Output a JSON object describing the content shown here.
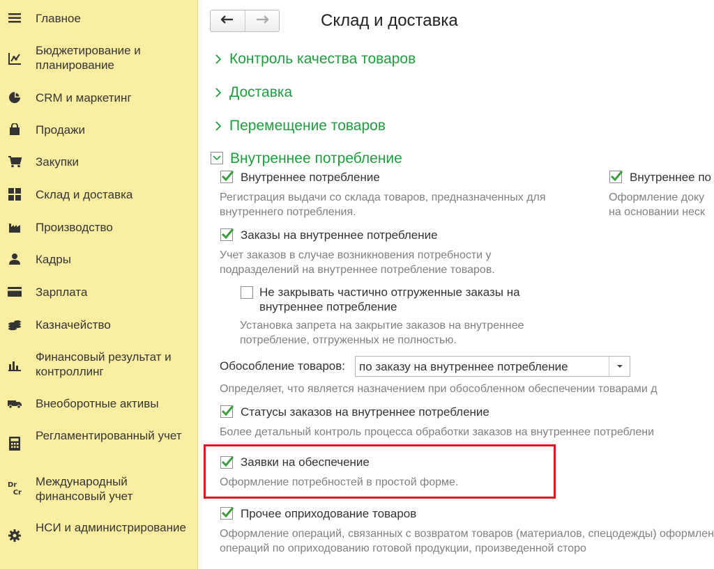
{
  "sidebar": {
    "items": [
      {
        "label": "Главное",
        "icon": "menu-icon"
      },
      {
        "label": "Бюджетирование и планирование",
        "icon": "budget-chart-icon"
      },
      {
        "label": "CRM и маркетинг",
        "icon": "pie-chart-icon"
      },
      {
        "label": "Продажи",
        "icon": "shopping-bag-icon"
      },
      {
        "label": "Закупки",
        "icon": "cart-icon"
      },
      {
        "label": "Склад и доставка",
        "icon": "warehouse-grid-icon"
      },
      {
        "label": "Производство",
        "icon": "factory-icon"
      },
      {
        "label": "Кадры",
        "icon": "person-icon"
      },
      {
        "label": "Зарплата",
        "icon": "wallet-icon"
      },
      {
        "label": "Казначейство",
        "icon": "coins-icon"
      },
      {
        "label": "Финансовый результат и контроллинг",
        "icon": "bar-chart-icon"
      },
      {
        "label": "Внеоборотные активы",
        "icon": "truck-icon"
      },
      {
        "label": "Регламентированный учет",
        "icon": "calculator-icon"
      },
      {
        "label": "Международный финансовый учет",
        "icon": "dr-cr-icon",
        "icon_text": "Dr\nCr"
      },
      {
        "label": "НСИ и администрирование",
        "icon": "gear-icon"
      }
    ]
  },
  "header": {
    "back": "←",
    "forward": "→",
    "title": "Склад и доставка"
  },
  "sections": {
    "quality": "Контроль качества товаров",
    "delivery": "Доставка",
    "movement": "Перемещение товаров",
    "internal": "Внутреннее потребление"
  },
  "options": {
    "internal": {
      "label": "Внутреннее потребление",
      "checked": true,
      "desc": "Регистрация выдачи со склада товаров, предназначенных для внутреннего потребления."
    },
    "internal_right": {
      "label": "Внутреннее по",
      "checked": true,
      "desc": "Оформление доку на основании неск"
    },
    "orders": {
      "label": "Заказы на внутреннее потребление",
      "checked": true,
      "desc": "Учет заказов в случае возникновения потребности у подразделений на внутреннее потребление товаров."
    },
    "no_close": {
      "label": "Не закрывать частично отгруженные заказы на внутреннее потребление",
      "checked": false,
      "desc": "Установка запрета на закрытие заказов на внутреннее потребление, отгруженных не полностью."
    },
    "isolation": {
      "label": "Обособление товаров:",
      "value": "по заказу на внутреннее потребление",
      "desc": "Определяет, что является назначением при обособленном обеспечении товарами д"
    },
    "statuses": {
      "label": "Статусы заказов на внутреннее потребление",
      "checked": true,
      "desc": "Более детальный контроль процесса обработки заказов на внутреннее потреблени"
    },
    "requests": {
      "label": "Заявки на обеспечение",
      "checked": true,
      "desc": "Оформление потребностей в простой форме."
    },
    "other": {
      "label": "Прочее оприходование товаров",
      "checked": true,
      "desc": "Оформление операций, связанных с возвратом товаров (материалов, спецодежды) оформлением операций по оприходованию готовой продукции, произведенной сторо"
    }
  },
  "colors": {
    "sidebar_bg": "#fbeea2",
    "section_green": "#1f9d3e",
    "check_green": "#3a9e3a",
    "highlight_red": "#e0161e"
  }
}
